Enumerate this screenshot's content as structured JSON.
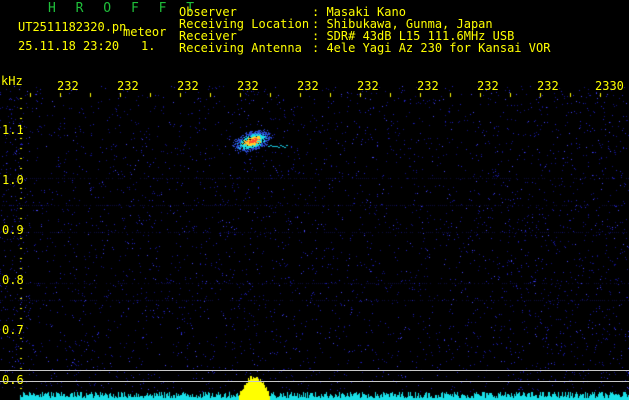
{
  "header": {
    "title": "H R O F F T",
    "filename": "UT2511182320.pn",
    "mode": "meteor",
    "datetime": "25.11.18 23:20",
    "index": "1.",
    "observer_label": "Observer",
    "observer_value": ": Masaki Kano",
    "location_label": "Receiving Location",
    "location_value": ": Shibukawa, Gunma, Japan",
    "receiver_label": "Receiver",
    "receiver_value": ": SDR# 43dB L15 111.6MHz USB",
    "antenna_label": "Receiving Antenna",
    "antenna_value": ": 4ele Yagi Az 230 for Kansai VOR"
  },
  "axes": {
    "y_unit": "kHz",
    "y_ticks": [
      "1.1",
      "1.0",
      "0.9",
      "0.8",
      "0.7",
      "0.6"
    ],
    "x_ticks": [
      "232",
      "232",
      "232",
      "232",
      "232",
      "232",
      "232",
      "232",
      "232",
      "2330"
    ]
  },
  "colors": {
    "background": "#000000",
    "text": "#ffff00",
    "title": "#1fbf3a",
    "noise": "#1a1ad0",
    "echo_core": "#ff4a2a",
    "echo_mid": "#19e0e8",
    "baseline": "#19e0e8",
    "power_peak": "#ffff00"
  }
}
